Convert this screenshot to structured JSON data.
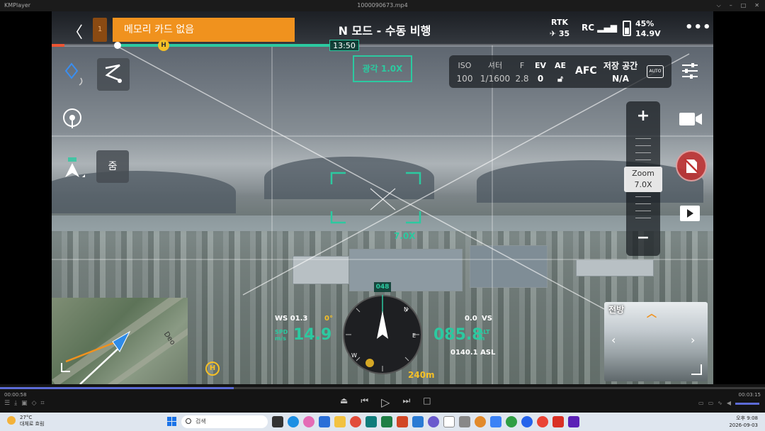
{
  "player": {
    "app_name": "KMPlayer",
    "file_name": "1000090673.mp4",
    "time_current": "00:00:58",
    "time_total": "00:03:15"
  },
  "hud": {
    "warning_index": "1",
    "warning_text": "메모리 카드 없음",
    "flight_mode": "N 모드 - 수동 비행",
    "rtk_label": "RTK",
    "rtk_sats": "35",
    "rc_label": "RC",
    "battery_percent": "45%",
    "battery_voltage": "14.9V",
    "flight_time": "13:50",
    "home_marker": "H",
    "lens_label": "광각 1.0X",
    "focus_zoom": "7.0X",
    "heading": "048",
    "wind_speed": "WS 01.3",
    "wind_angle": "0°",
    "speed_label_top": "SPD",
    "speed_label_unit": "m/s",
    "speed": "14.9",
    "vs_value": "0.0",
    "vs_label": "VS",
    "altitude": "085.8",
    "alt_label_top": "ALT",
    "alt_label_unit": "m",
    "asl": "0140.1 ASL",
    "distance": "240m",
    "compass_home": "H"
  },
  "camera": {
    "iso_label": "ISO",
    "iso_value": "100",
    "shutter_label": "셔터",
    "shutter_value": "1/1600",
    "fstop_label": "F",
    "fstop_value": "2.8",
    "ev_label": "EV",
    "ev_value": "0",
    "ae_label": "AE",
    "afc": "AFC",
    "storage_label": "저장 공간",
    "storage_value": "N/A",
    "auto_badge": "AUTO"
  },
  "zoom": {
    "plus": "+",
    "minus": "−",
    "label": "Zoom",
    "value": "7.0X",
    "button": "줌"
  },
  "pip": {
    "title": "전방"
  },
  "minimap": {
    "road_label": "Deo"
  },
  "taskbar": {
    "weather_temp": "27°C",
    "weather_desc": "대체로 흐림",
    "search_placeholder": "검색",
    "time": "오후 9:08",
    "date": "2026-09-03"
  },
  "colors": {
    "accent": "#2cc9a0",
    "warning": "#f0921e",
    "home": "#f6c026"
  }
}
